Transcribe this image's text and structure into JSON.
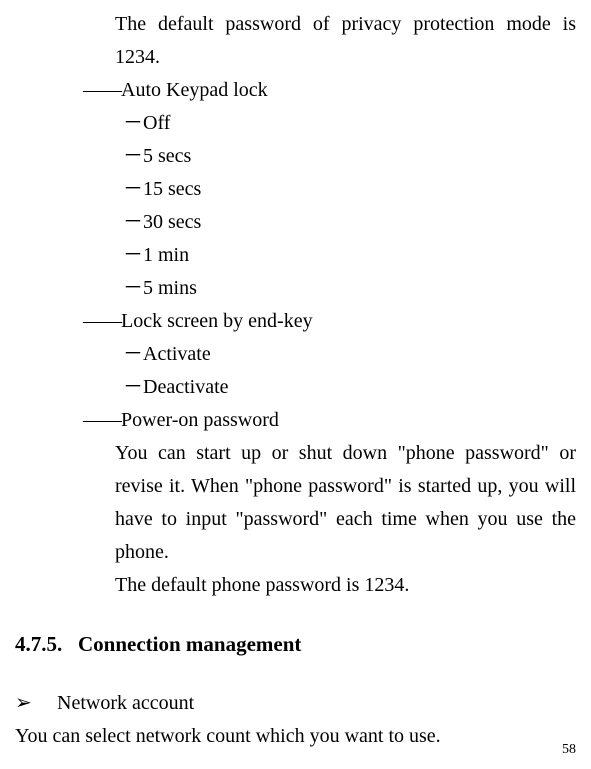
{
  "privacy_default_password_text": "The default password of privacy protection mode is 1234.",
  "auto_keypad_lock": {
    "prefix": "――",
    "title": "Auto Keypad lock",
    "items_prefix": "－",
    "items": [
      "Off",
      "5 secs",
      "15 secs",
      "30 secs",
      "1 min",
      "5 mins"
    ]
  },
  "lock_screen": {
    "prefix": "――",
    "title": "Lock screen by end-key",
    "items_prefix": "－",
    "items": [
      "Activate",
      "Deactivate"
    ]
  },
  "power_on": {
    "prefix": "――",
    "title": "Power-on password",
    "description": "You can start up or shut down \"phone password\" or revise it. When \"phone password\" is started up, you will have to input \"password\" each time when you use the phone.",
    "default_text": "The default phone password is 1234."
  },
  "section": {
    "number": "4.7.5.",
    "title": "Connection management"
  },
  "network_account": {
    "arrow": "➢",
    "title": "Network account",
    "body": "You can select network count which you want to use."
  },
  "page_number": "58"
}
